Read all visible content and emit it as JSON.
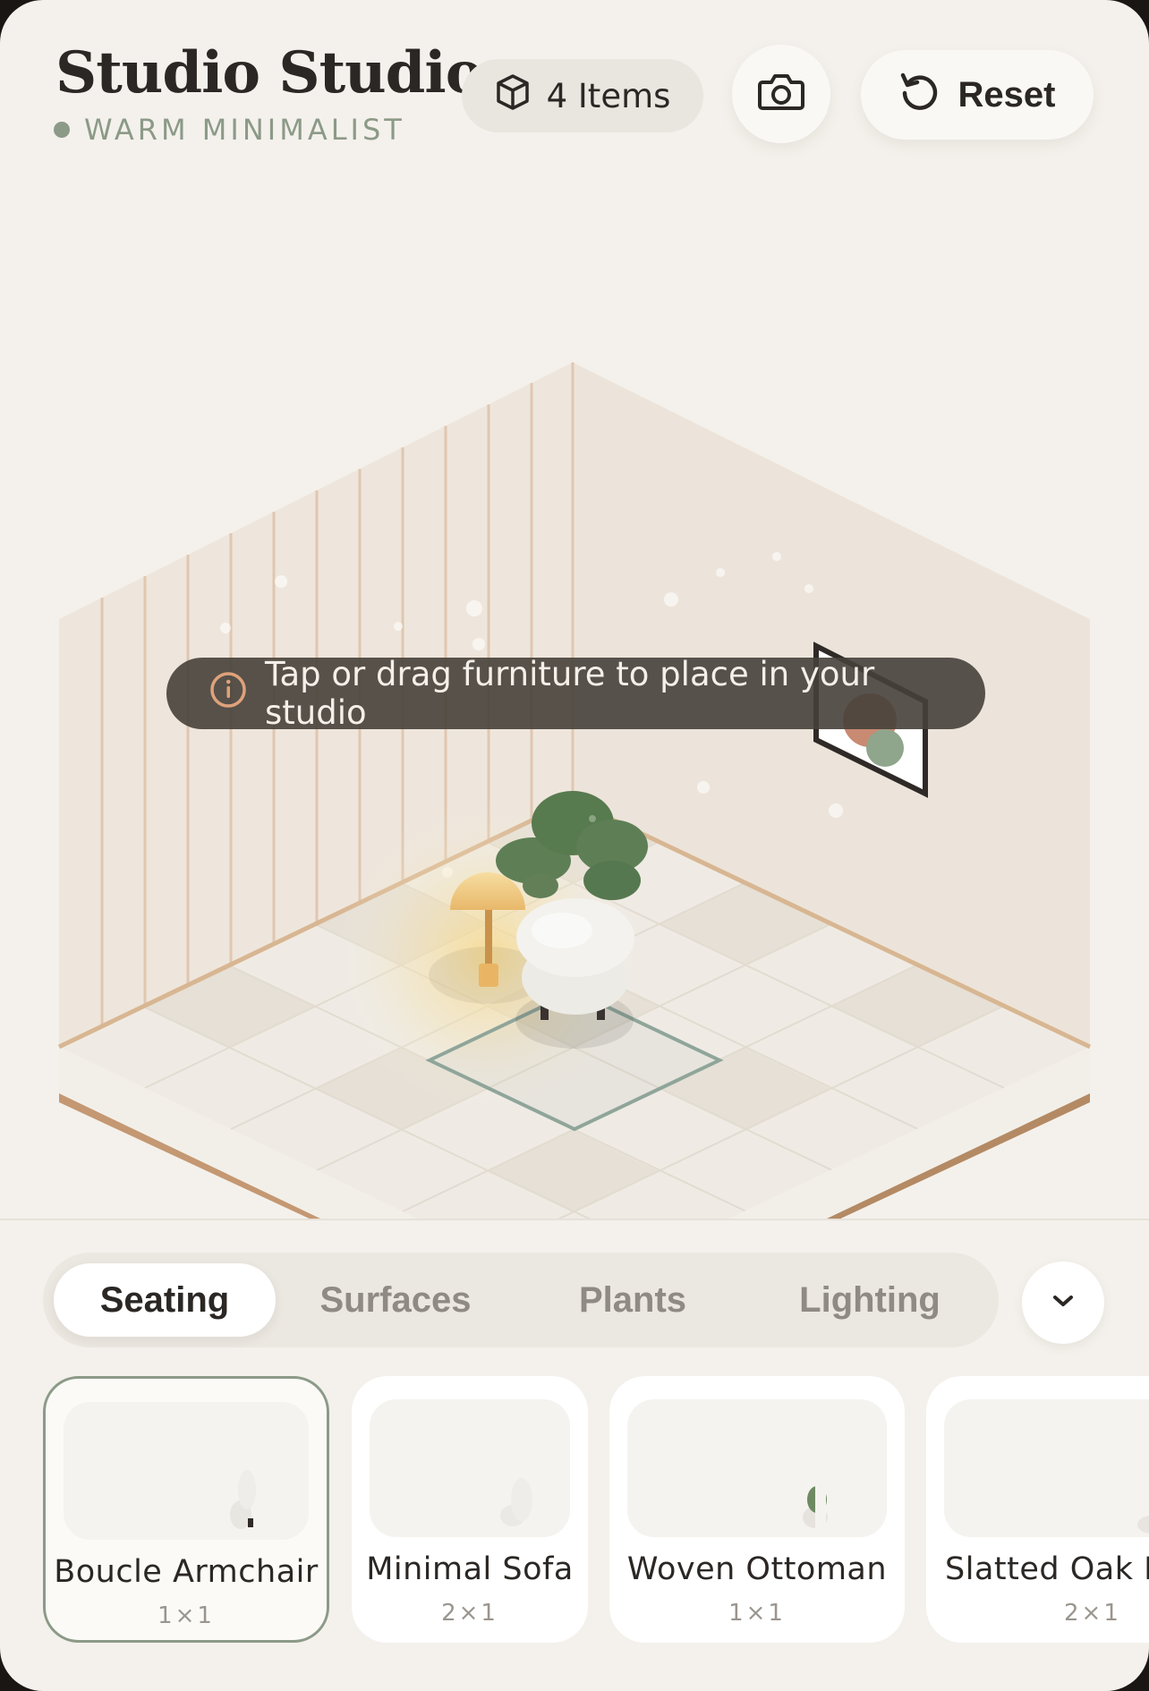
{
  "header": {
    "title": "Studio Studio",
    "subtitle": "WARM MINIMALIST",
    "items_label": "4 Items",
    "reset_label": "Reset"
  },
  "scene": {
    "hint": "Tap or drag furniture to place in your studio"
  },
  "tabs": [
    {
      "label": "Seating",
      "active": true
    },
    {
      "label": "Surfaces",
      "active": false
    },
    {
      "label": "Plants",
      "active": false
    },
    {
      "label": "Lighting",
      "active": false
    }
  ],
  "catalog": [
    {
      "name": "Boucle Armchair",
      "size": "1×1",
      "selected": true
    },
    {
      "name": "Minimal Sofa",
      "size": "2×1",
      "selected": false
    },
    {
      "name": "Woven Ottoman",
      "size": "1×1",
      "selected": false
    },
    {
      "name": "Slatted Oak Bench",
      "size": "2×1",
      "selected": false
    }
  ],
  "colors": {
    "background": "#f4f1ec",
    "accent_sage": "#8c9a88",
    "wood": "#b98f6a",
    "text": "#2b2724"
  },
  "icons": [
    "cube-icon",
    "camera-icon",
    "reset-icon",
    "info-icon",
    "chevron-down-icon"
  ]
}
